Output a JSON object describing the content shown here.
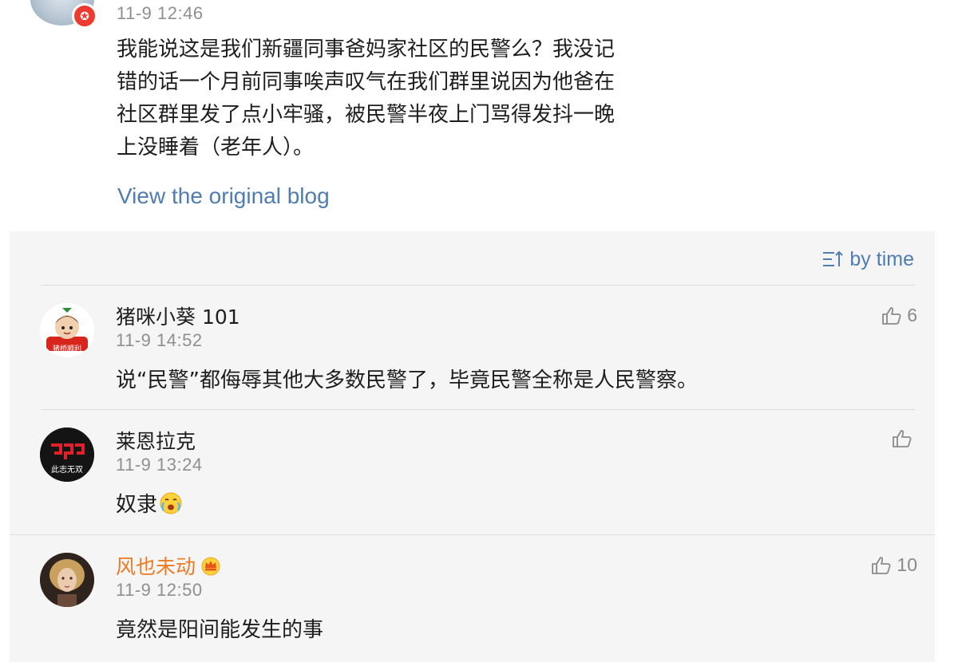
{
  "post": {
    "timestamp": "11-9 12:46",
    "body_lines": [
      "我能说这是我们新疆同事爸妈家社区的民警么？我没记",
      "错的话一个月前同事唉声叹气在我们群里说因为他爸在",
      "社区群里发了点小牢骚，被民警半夜上门骂得发抖一晚",
      "上没睡着（老年人）。"
    ],
    "view_original_label": "View the original blog"
  },
  "sort": {
    "label": "by time",
    "icon": "sort-icon"
  },
  "comments": [
    {
      "username": "猪咪小葵 101",
      "timestamp": "11-9 14:52",
      "text": "说“民警”都侮辱其他大多数民警了，毕竟民警全称是人民警察。",
      "likes": "6",
      "avatar_caption": "猪桥顺利"
    },
    {
      "username": "莱恩拉克",
      "timestamp": "11-9 13:24",
      "text": "奴隶",
      "likes": "",
      "avatar_caption": "此志无双",
      "emoji": "crying-face-emoji"
    },
    {
      "username": "风也未动",
      "timestamp": "11-9 12:50",
      "text": "竟然是阳间能发生的事",
      "likes": "10",
      "badge": "crown-icon"
    }
  ],
  "colors": {
    "link": "#4f7db3",
    "vip_name": "#eb7a22",
    "panel_bg": "#f5f5f5",
    "muted": "#8f8f8f"
  }
}
